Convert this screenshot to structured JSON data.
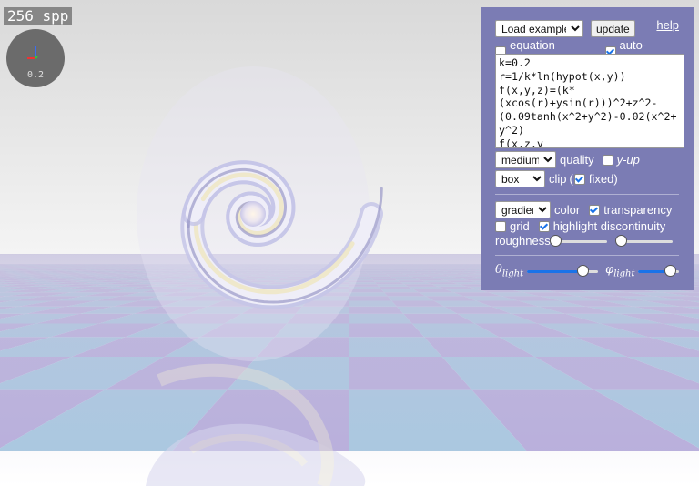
{
  "render": {
    "spp_label": "256 spp",
    "scale_label": "0.2"
  },
  "toolbar": {
    "example_select": "Load example...",
    "update_label": "update",
    "help_label": "help"
  },
  "options": {
    "equation_preview": {
      "label": "equation preview",
      "checked": false
    },
    "auto_update": {
      "label": "auto-update",
      "checked": true
    }
  },
  "equation": {
    "text": "k=0.2\nr=1/k*ln(hypot(x,y))\nf(x,y,z)=(k*(xcos(r)+ysin(r)))^2+z^2-(0.09tanh(x^2+y^2)-0.02(x^2+y^2)\nf(x,z,y"
  },
  "quality": {
    "select": "medium",
    "label": "quality",
    "y_up": {
      "label": "y-up",
      "checked": false
    }
  },
  "clip": {
    "select": "box",
    "label": "clip",
    "fixed": {
      "label": "fixed",
      "checked": true
    }
  },
  "coloring": {
    "select": "gradient",
    "label": "color",
    "transparency": {
      "label": "transparency",
      "checked": true
    },
    "grid": {
      "label": "grid",
      "checked": false
    },
    "highlight": {
      "label": "highlight discontinuity",
      "checked": true
    },
    "roughness_label": "roughness",
    "roughness_value": 0.0,
    "second_value": 0.0
  },
  "light": {
    "theta_symbol": "θ",
    "phi_symbol": "φ",
    "sub": "light",
    "theta_value": 0.8,
    "phi_value": 0.8
  },
  "colors": {
    "panel": "#7b7cb4",
    "check": "#1a73e8",
    "floor_a": "#b8aedc",
    "floor_b": "#a8c8e0"
  }
}
